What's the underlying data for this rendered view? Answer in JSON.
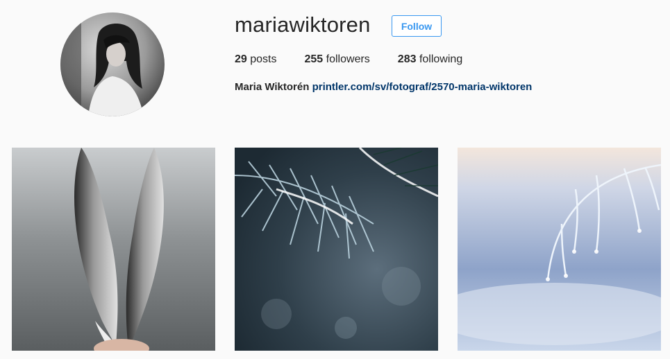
{
  "profile": {
    "username": "mariawiktoren",
    "follow_label": "Follow",
    "full_name": "Maria Wiktorén",
    "website": "printler.com/sv/fotograf/2570-maria-wiktoren"
  },
  "stats": [
    {
      "count": "29",
      "label": "posts"
    },
    {
      "count": "255",
      "label": "followers"
    },
    {
      "count": "283",
      "label": "following"
    }
  ],
  "posts": [
    {
      "subject": "feathers"
    },
    {
      "subject": "frosted pine branch"
    },
    {
      "subject": "frozen grass stems"
    }
  ],
  "colors": {
    "accent": "#3897f0",
    "link": "#003569",
    "background": "#fafafa",
    "text": "#262626"
  }
}
